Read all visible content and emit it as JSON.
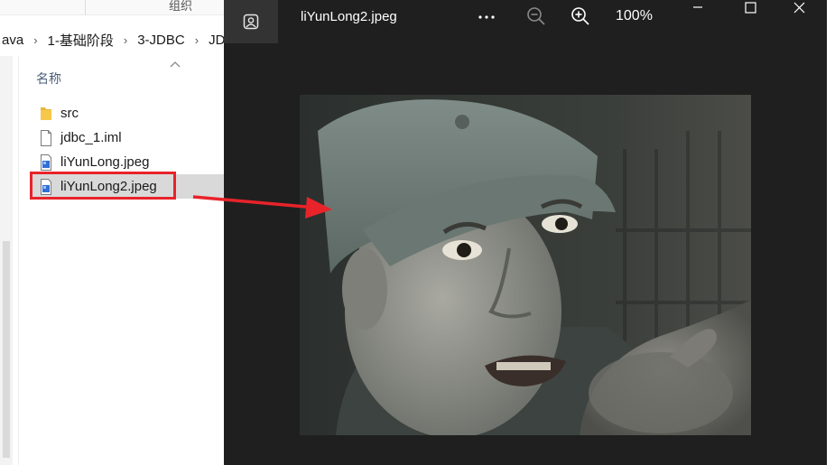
{
  "explorer": {
    "ribbon": {
      "group_label": "组织"
    },
    "breadcrumb": [
      "ava",
      "1-基础阶段",
      "3-JDBC",
      "JDB"
    ],
    "column_header": "名称",
    "files": [
      {
        "name": "src",
        "icon": "folder-icon"
      },
      {
        "name": "jdbc_1.iml",
        "icon": "file-icon"
      },
      {
        "name": "liYunLong.jpeg",
        "icon": "image-file-icon"
      },
      {
        "name": "liYunLong2.jpeg",
        "icon": "image-file-icon",
        "selected": true
      }
    ],
    "highlight_color": "#e8232a"
  },
  "viewer": {
    "title": "liYunLong2.jpeg",
    "zoom": "100%",
    "more_label": "···",
    "background": "#1f1f1f"
  },
  "annotation": {
    "arrow_color": "#e8232a"
  }
}
